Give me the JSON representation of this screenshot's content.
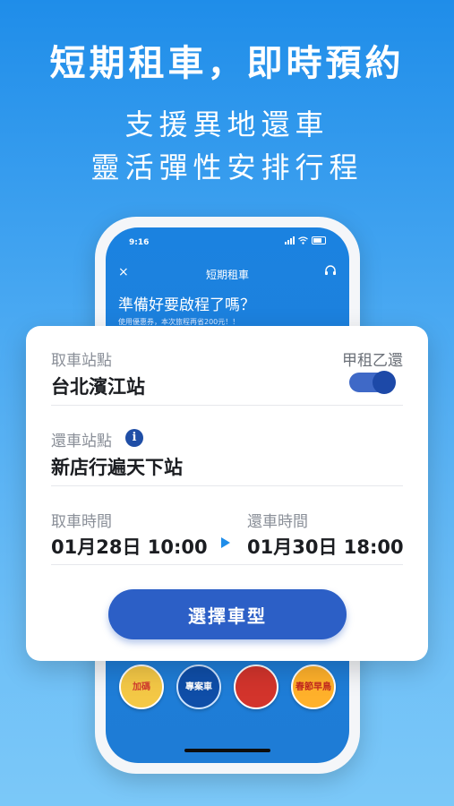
{
  "headline": {
    "title": "短期租車，即時預約",
    "subtitle_line1": "支援異地還車",
    "subtitle_line2": "靈活彈性安排行程"
  },
  "phone": {
    "status_time": "9:16",
    "app_title": "短期租車",
    "close_icon": "×",
    "question": "準備好要啟程了嗎？",
    "promo": "使用優惠券，本次旅程再省200元！！",
    "bottom_icons": [
      {
        "label": "加碼",
        "icon": "bonus-icon"
      },
      {
        "label": "專案車",
        "icon": "car-project-icon"
      },
      {
        "label": "",
        "icon": "festival-icon"
      },
      {
        "label": "春節早鳥",
        "icon": "spring-early-bird-icon"
      }
    ]
  },
  "card": {
    "pickup_label": "取車站點",
    "pickup_value": "台北濱江站",
    "oneway_label": "甲租乙還",
    "return_label": "還車站點",
    "return_value": "新店行遍天下站",
    "pickup_time_label": "取車時間",
    "pickup_time_value": "01月28日 10:00",
    "return_time_label": "還車時間",
    "return_time_value": "01月30日 18:00",
    "select_button": "選擇車型",
    "info_icon": "i"
  },
  "colors": {
    "background_top": "#1f8de9",
    "background_bottom": "#7bc8f8",
    "accent": "#2c5fc6",
    "toggle_on": "#1d49a8"
  }
}
